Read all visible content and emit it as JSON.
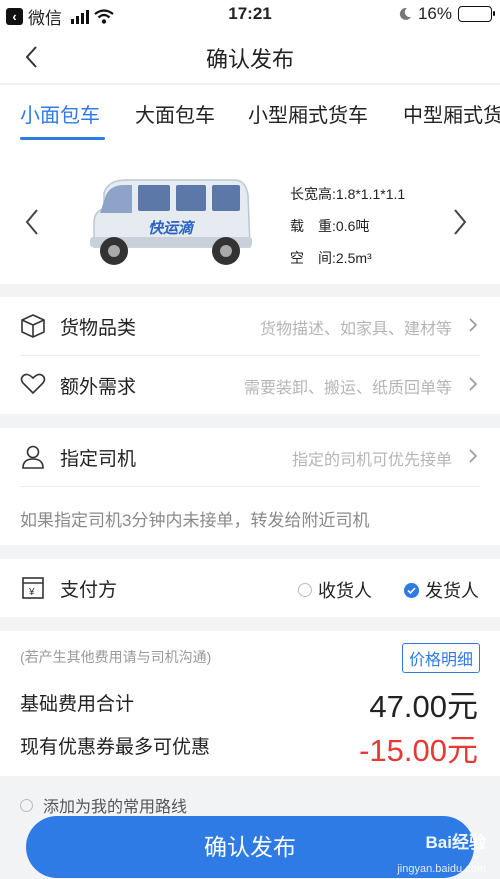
{
  "status_bar": {
    "carrier": "微信",
    "time": "17:21",
    "battery": "16%",
    "battery_level": 0.16
  },
  "nav": {
    "title": "确认发布"
  },
  "tabs": [
    {
      "label": "小面包车",
      "active": true
    },
    {
      "label": "大面包车",
      "active": false
    },
    {
      "label": "小型厢式货车",
      "active": false
    },
    {
      "label": "中型厢式货车",
      "active": false
    }
  ],
  "vehicle": {
    "brand_text": "快运滴",
    "specs": [
      "长宽高:1.8*1.1*1.1",
      "载　重:0.6吨",
      "空　间:2.5m³"
    ]
  },
  "cargo": {
    "category_label": "货物品类",
    "category_hint": "货物描述、如家具、建材等",
    "extra_label": "额外需求",
    "extra_hint": "需要装卸、搬运、纸质回单等"
  },
  "driver": {
    "label": "指定司机",
    "hint": "指定的司机可优先接单",
    "note": "如果指定司机3分钟内未接单，转发给附近司机"
  },
  "payment": {
    "label": "支付方",
    "options": [
      {
        "label": "收货人",
        "selected": false
      },
      {
        "label": "发货人",
        "selected": true
      }
    ]
  },
  "fee": {
    "note": "(若产生其他费用请与司机沟通)",
    "detail_button": "价格明细",
    "base_label": "基础费用合计",
    "base_value": "47.00元",
    "coupon_label": "现有优惠券最多可优惠",
    "coupon_value": "-15.00元"
  },
  "route": {
    "label": "添加为我的常用路线"
  },
  "confirm_button": "确认发布",
  "watermark": {
    "main": "Bai经验",
    "sub": "jingyan.baidu.com"
  },
  "colors": {
    "accent": "#2f7be5",
    "discount": "#e53935",
    "background": "#f2f3f5"
  }
}
